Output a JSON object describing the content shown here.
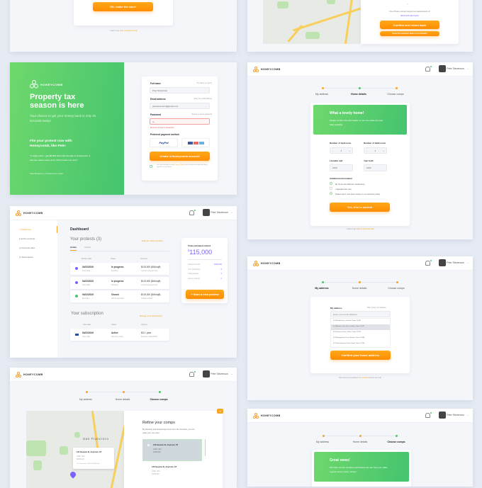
{
  "common": {
    "brand": "HONEYCOMB",
    "user_name": "Pete Stevenson",
    "steps": [
      "My address",
      "Home details",
      "Choose comps"
    ]
  },
  "panel_make_case": {
    "button": "OK, make the case!",
    "footer_prefix": "I want to go",
    "footer_link": "back to previous step"
  },
  "panel_map_confirm": {
    "assessment_text": "Your chosen comps support an assessment of:",
    "assessment_value": "$115,000 ($xx/sqft)",
    "confirm_button": "Confirm and return back",
    "reset_button": "Reset the selection back to our defaults"
  },
  "signup": {
    "headline": "Property tax season is here",
    "subline": "Your chance to get your money back is only 30 seconds away!",
    "cta": "File your protest now with Honeycomb, like Pete:",
    "quote": "\"It really works. I got $8,000 back with the help of Honeycomb. It was the easiest setup and I will be back next year!\"",
    "attribution": "Pete Stevenson, a Texas home owner",
    "form": {
      "full_name_label": "Full name",
      "full_name_hint": "The name you go by",
      "full_name_value": "Pete Stevenson",
      "email_label": "Email address",
      "email_hint": "Enter the email address",
      "email_value": "petestevenson@gmail.com",
      "password_label": "Password",
      "password_hint": "Choose a secure password",
      "password_value": "•••",
      "password_error": "Must be at least 6 characters",
      "payment_label": "Preferred payment method",
      "paypal": "PayPal",
      "submit": "Create a Honeycomb account",
      "terms_prefix": "I've read and agree to the",
      "terms_link": "Privacy Policy",
      "terms_rest": "and consent to Honeycomb filing protests on my behalf."
    }
  },
  "dashboard": {
    "sidebar": [
      "Dashboard",
      "Active protests",
      "Personal data",
      "Subscription"
    ],
    "title": "Dashboard",
    "protests_title": "Your protests",
    "protests_count": "(3)",
    "edit_link": "Edit your active protests",
    "tabs": [
      "Active",
      "Closed"
    ],
    "columns": [
      "Protest date",
      "Status",
      "Amounts"
    ],
    "rows": [
      {
        "date": "04/22/2019",
        "date_sub": "Start date",
        "status": "In progress",
        "status_sub": "Pending",
        "amount": "$115,000 ($44/sqft)",
        "amount_sub": "Current assessment",
        "color": "#7b61ff"
      },
      {
        "date": "04/22/2019",
        "date_sub": "Start date",
        "status": "In progress",
        "status_sub": "Pending",
        "amount": "$115,000 ($44/sqft)",
        "amount_sub": "Current assessment",
        "color": "#7b61ff"
      },
      {
        "date": "04/22/2019",
        "date_sub": "End date",
        "status": "Closed",
        "status_sub": "Refund granted",
        "amount": "$115,000 ($44/sqft)",
        "amount_sub": "Closed refund",
        "color": "#4cc56a"
      }
    ],
    "subscription_title": "Your subscription",
    "manage_link": "Manage your subscription",
    "sub_columns": [
      "Start date",
      "Status",
      "Options"
    ],
    "sub_row": {
      "date": "04/22/2019",
      "date_sub": "Start date",
      "status": "Active",
      "status_sub": "Renews yearly",
      "option": "$10 / year",
      "option_sub": "Renews 04/22/2020"
    },
    "refund_title": "Total estimated refund",
    "refund_currency": "$",
    "refund_value": "115,000",
    "stats": [
      {
        "label": "Closed refunds",
        "value": "$150,000"
      },
      {
        "label": "Your properties",
        "value": "3"
      },
      {
        "label": "Total protests",
        "value": "3"
      },
      {
        "label": "Active protests",
        "value": "2"
      }
    ],
    "new_protest": "+ Start a new protest"
  },
  "home_details": {
    "banner_title": "What a lovely home!",
    "banner_text": "Please confirm this information so we can make the best case possible.",
    "bedrooms_label": "Number of bedrooms",
    "bedrooms_value": "4",
    "bathrooms_label": "Number of bathrooms",
    "bathrooms_value": "3",
    "sqft_label": "Liveable sqft",
    "sqft_value": "2400",
    "year_label": "Year built",
    "year_value": "1992",
    "additional_label": "Additional information",
    "checks": [
      "My home has deferred maintenance",
      "I appealed last year",
      "Please see if I can save money on my insurance policy"
    ],
    "submit": "Yes, this is correct",
    "footer_prefix": "I want to go",
    "footer_link": "back to previous step"
  },
  "my_address": {
    "label": "My address",
    "hint": "Start typing your address",
    "placeholder": "Enter your home address",
    "suggestions": [
      "474 Marilla Drive, Garland, Texas 75040",
      "474 Abrams Oaks Drive, Dallas, Texas 75243",
      "474 Hemeon Drive, Dallas, Texas 75224",
      "474 Montgomery Drive, Rowlett, Texas 75088",
      "474 North Hemmer Drive, Hyde, Texas 75138"
    ],
    "submit": "Confirm your home address",
    "footer_prefix": "Did not find your address?",
    "footer_link": "Let us know",
    "footer_suffix": "and we can help"
  },
  "comps": {
    "title": "Refine your comps",
    "text": "By selecting and deselecting homes from the list below, you can make your own case.",
    "map_label": "San Francisco",
    "popup_address": "123 Sesame St, Anytown, ST",
    "popup_line1": "2400, 3bd",
    "popup_line2": "$100/sqft",
    "popup_note": "Tax assessment: $115,000 ($44/sqft)",
    "items": [
      {
        "address": "123 Sesame St, Anytown, ST",
        "line1": "2400, 3bd",
        "line2": "$100/sqft"
      },
      {
        "address": "123 Sesame St, Anytown, ST",
        "line1": "2400, 3bd",
        "line2": "$100/sqft"
      }
    ],
    "close_icon": "x"
  },
  "great_news": {
    "title": "Great news!",
    "text": "We have run the numbers and believe we can help you make a great case to save money!"
  }
}
